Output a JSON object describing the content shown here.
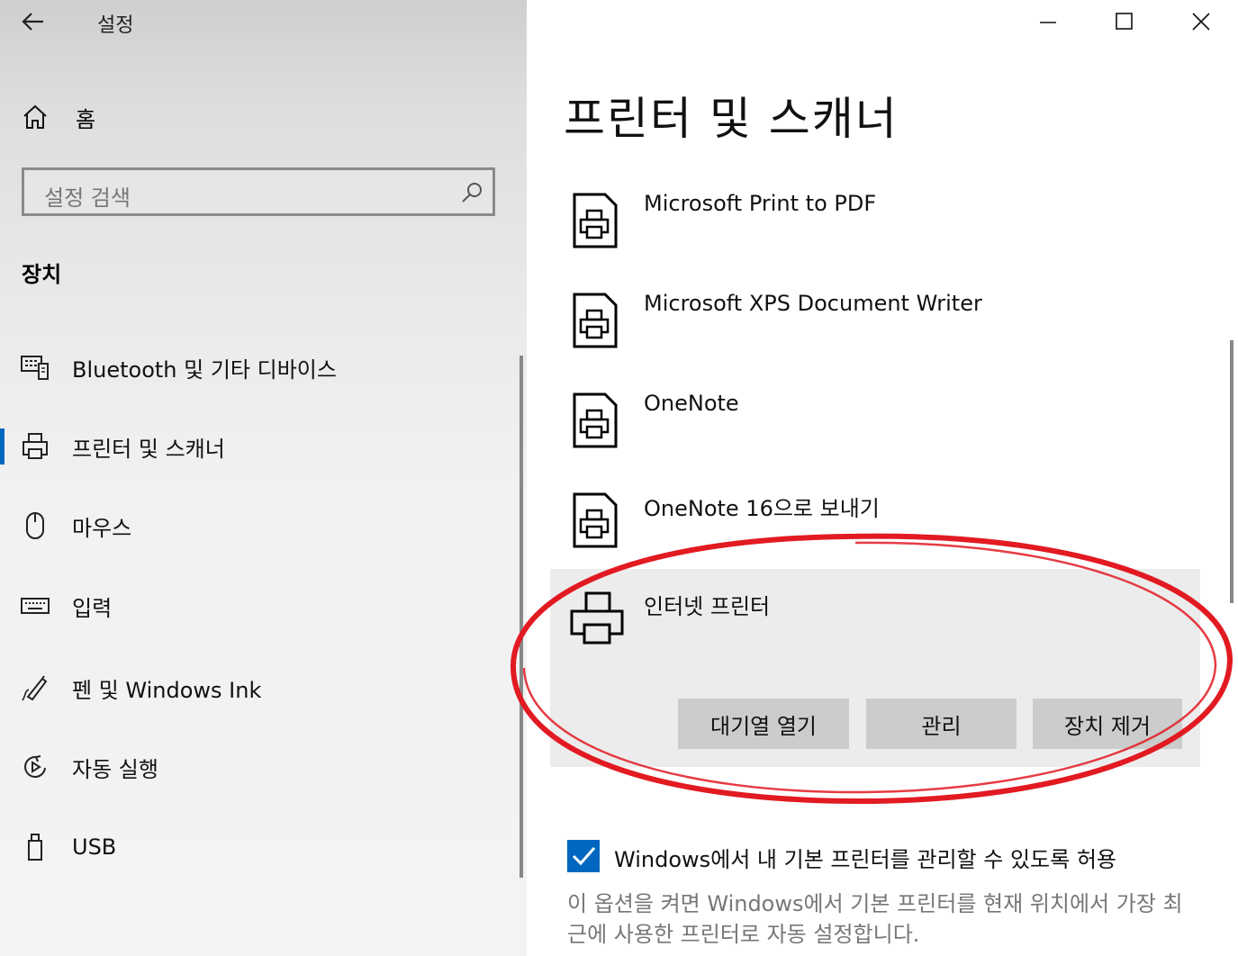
{
  "app": {
    "title": "설정"
  },
  "sidebar": {
    "home_label": "홈",
    "search_placeholder": "설정 검색",
    "section_title": "장치",
    "items": [
      {
        "label": "Bluetooth 및 기타 디바이스",
        "icon": "keyboard-device-icon"
      },
      {
        "label": "프린터 및 스캐너",
        "icon": "printer-icon",
        "active": true
      },
      {
        "label": "마우스",
        "icon": "mouse-icon"
      },
      {
        "label": "입력",
        "icon": "keyboard-icon"
      },
      {
        "label": "펜 및 Windows Ink",
        "icon": "pen-icon"
      },
      {
        "label": "자동 실행",
        "icon": "autoplay-icon"
      },
      {
        "label": "USB",
        "icon": "usb-icon"
      }
    ]
  },
  "main": {
    "title": "프린터 및 스캐너",
    "printers": [
      {
        "name": "Microsoft Print to PDF"
      },
      {
        "name": "Microsoft XPS Document Writer"
      },
      {
        "name": "OneNote"
      },
      {
        "name": "OneNote 16으로 보내기"
      }
    ],
    "selected_printer": {
      "name": "인터넷 프린터",
      "buttons": {
        "open_queue": "대기열 열기",
        "manage": "관리",
        "remove": "장치 제거"
      }
    },
    "default_printer": {
      "checked": true,
      "label": "Windows에서 내 기본 프린터를 관리할 수 있도록 허용",
      "description": "이 옵션을 켜면 Windows에서 기본 프린터를 현재 위치에서 가장 최근에 사용한 프린터로 자동 설정합니다."
    }
  },
  "colors": {
    "accent": "#0067c0",
    "annotation": "#e21a22"
  }
}
